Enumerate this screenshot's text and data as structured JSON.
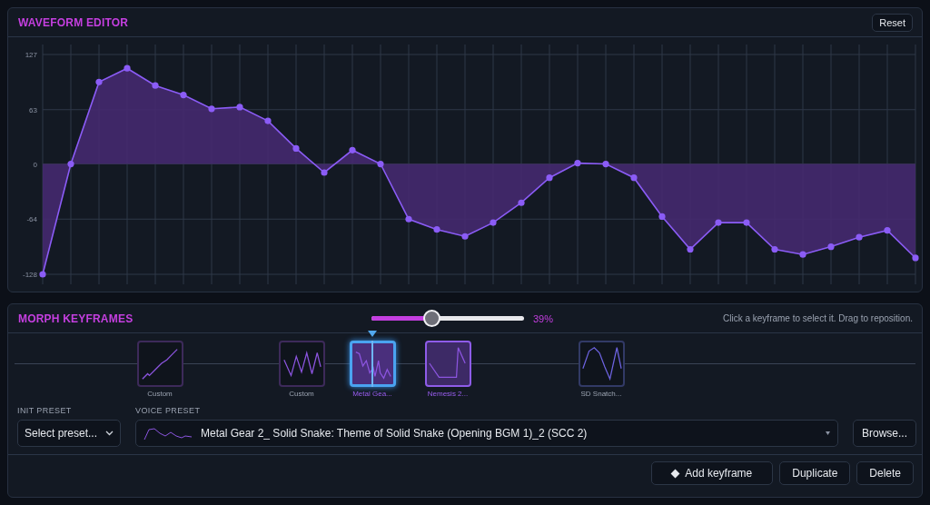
{
  "waveform_editor": {
    "title": "WAVEFORM EDITOR",
    "reset_button": "Reset",
    "chart_data": {
      "type": "area",
      "grid": true,
      "ylim": [
        -128,
        127
      ],
      "yticks": [
        127,
        63,
        0,
        -64,
        -128
      ],
      "series": [
        {
          "color": "#8b5cf6",
          "values": [
            -128,
            0,
            95,
            111,
            91,
            80,
            64,
            66,
            50,
            18,
            -10,
            16,
            0,
            -64,
            -76,
            -84,
            -68,
            -45,
            -16,
            1,
            0,
            -16,
            -61,
            -99,
            -68,
            -68,
            -99,
            -105,
            -96,
            -85,
            -77,
            -109
          ]
        }
      ]
    }
  },
  "morph_keyframes": {
    "title": "MORPH KEYFRAMES",
    "morph": {
      "level": 0.39,
      "reading": "39%"
    },
    "hint": "Click a keyframe to select it. Drag to reposition.",
    "keyframes": [
      {
        "label": "Custom",
        "kind": "ramp",
        "selected": false,
        "highlighted": false
      },
      {
        "label": "Custom",
        "kind": "saw",
        "selected": false,
        "highlighted": false
      },
      {
        "label": "Metal Gea...",
        "kind": "noisy",
        "selected": true,
        "highlighted": false
      },
      {
        "label": "Nemesis 2...",
        "kind": "square",
        "selected": false,
        "highlighted": true
      },
      {
        "label": "SD Snatch...",
        "kind": "sine",
        "selected": false,
        "highlighted": false
      }
    ],
    "init_preset": {
      "label": "INIT PRESET",
      "value": "Select preset..."
    },
    "voice_preset": {
      "label": "VOICE PRESET",
      "value": "Metal Gear 2_ Solid Snake: Theme of Solid Snake (Opening BGM 1)_2 (SCC 2)",
      "browse_button": "Browse..."
    },
    "actions": [
      "Add keyframe",
      "Duplicate",
      "Delete"
    ]
  }
}
